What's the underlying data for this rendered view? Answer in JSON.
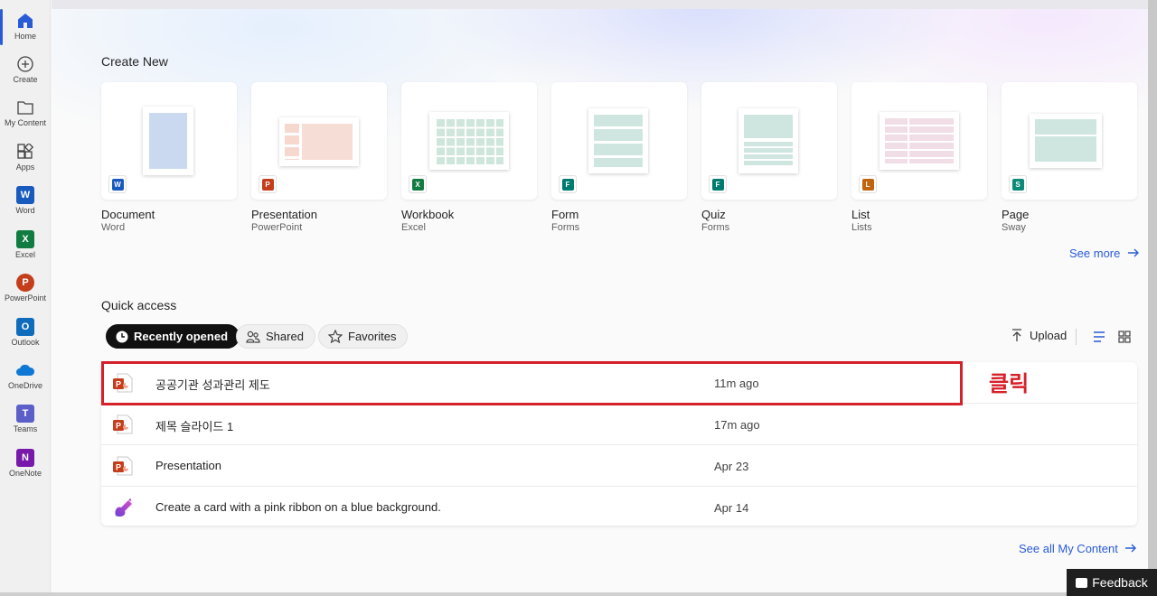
{
  "rail": {
    "items": [
      {
        "label": "Home",
        "icon": "home-icon"
      },
      {
        "label": "Create",
        "icon": "plus-circle-icon"
      },
      {
        "label": "My Content",
        "icon": "folder-icon"
      },
      {
        "label": "Apps",
        "icon": "apps-icon"
      },
      {
        "label": "Word",
        "icon": "word-icon",
        "letter": "W",
        "color": "#185abd"
      },
      {
        "label": "Excel",
        "icon": "excel-icon",
        "letter": "X",
        "color": "#107c41"
      },
      {
        "label": "PowerPoint",
        "icon": "powerpoint-icon",
        "letter": "P",
        "color": "#c43e1c"
      },
      {
        "label": "Outlook",
        "icon": "outlook-icon",
        "letter": "O",
        "color": "#0f6cbd"
      },
      {
        "label": "OneDrive",
        "icon": "onedrive-icon",
        "color": "#0f78d4"
      },
      {
        "label": "Teams",
        "icon": "teams-icon",
        "letter": "T",
        "color": "#5b5fc7"
      },
      {
        "label": "OneNote",
        "icon": "onenote-icon",
        "letter": "N",
        "color": "#7719aa"
      }
    ]
  },
  "create_new": {
    "title": "Create New",
    "cards": [
      {
        "title": "Document",
        "sub": "Word",
        "badge": "W",
        "color": "#185abd"
      },
      {
        "title": "Presentation",
        "sub": "PowerPoint",
        "badge": "P",
        "color": "#c43e1c"
      },
      {
        "title": "Workbook",
        "sub": "Excel",
        "badge": "X",
        "color": "#107c41"
      },
      {
        "title": "Form",
        "sub": "Forms",
        "badge": "F",
        "color": "#007c6f"
      },
      {
        "title": "Quiz",
        "sub": "Forms",
        "badge": "F",
        "color": "#007c6f"
      },
      {
        "title": "List",
        "sub": "Lists",
        "badge": "L",
        "color": "#c2640e"
      },
      {
        "title": "Page",
        "sub": "Sway",
        "badge": "S",
        "color": "#0b8a78"
      }
    ],
    "see_more": "See more"
  },
  "quick_access": {
    "title": "Quick access",
    "tabs": [
      "Recently opened",
      "Shared",
      "Favorites"
    ],
    "upload": "Upload",
    "files": [
      {
        "name": "공공기관 성과관리 제도",
        "time": "11m ago",
        "type": "powerpoint"
      },
      {
        "name": "제목 슬라이드 1",
        "time": "17m ago",
        "type": "powerpoint"
      },
      {
        "name": "Presentation",
        "time": "Apr 23",
        "type": "powerpoint"
      },
      {
        "name": "Create a card with a pink ribbon on a blue background.",
        "time": "Apr 14",
        "type": "designer"
      }
    ],
    "see_all": "See all My Content"
  },
  "annotation": {
    "label": "클릭",
    "color": "#d6202a"
  },
  "feedback": "Feedback"
}
